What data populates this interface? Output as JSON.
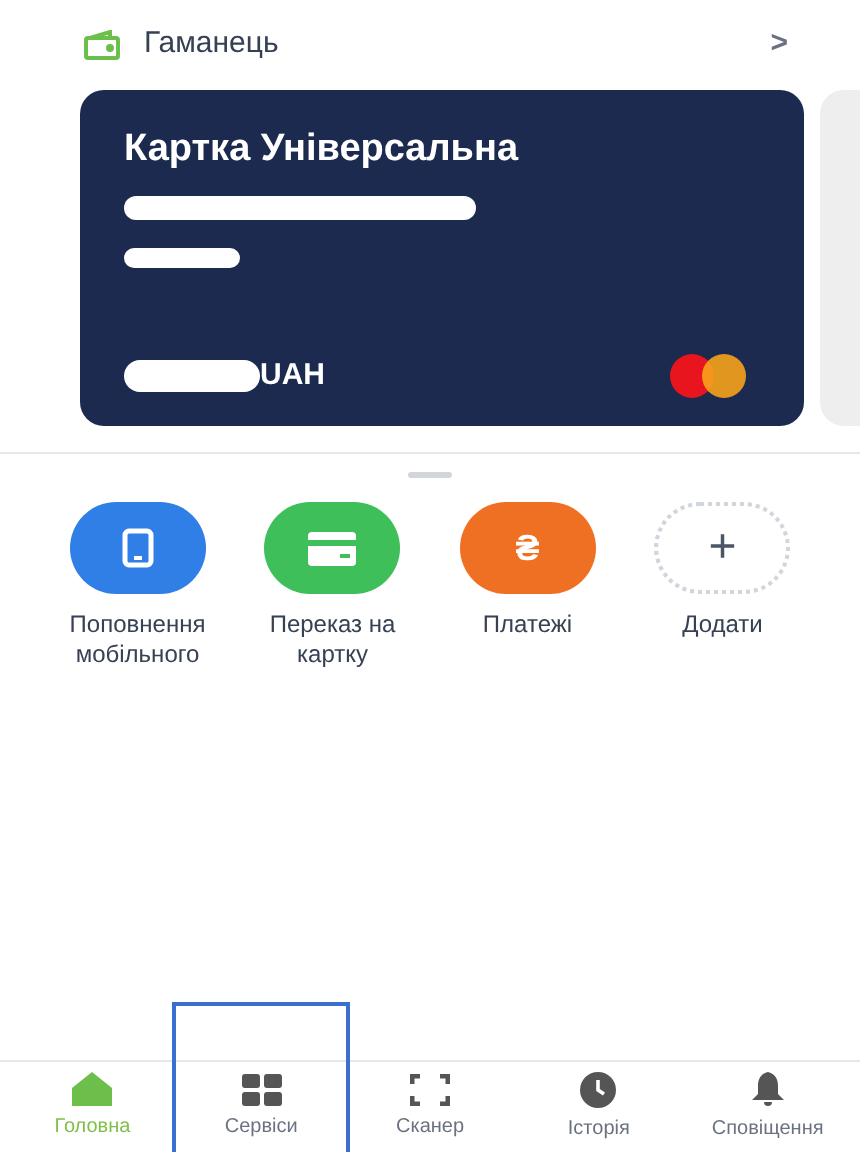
{
  "header": {
    "title": "Гаманець",
    "chevron": ">"
  },
  "card": {
    "name": "Картка Універсальна",
    "currency": "UAH"
  },
  "actions": [
    {
      "kind": "phone",
      "label": "Поповнення мобільного",
      "color": "#2f7fe6"
    },
    {
      "kind": "card",
      "label": "Переказ на картку",
      "color": "#3fbf5a"
    },
    {
      "kind": "hryvnia",
      "label": "Платежі",
      "color": "#f07023",
      "glyph": "₴"
    },
    {
      "kind": "add",
      "label": "Додати",
      "glyph": "+"
    }
  ],
  "nav": [
    {
      "kind": "home",
      "label": "Головна",
      "selected": true,
      "highlighted": false
    },
    {
      "kind": "grid",
      "label": "Сервіси",
      "selected": false,
      "highlighted": true
    },
    {
      "kind": "scan",
      "label": "Сканер",
      "selected": false,
      "highlighted": false
    },
    {
      "kind": "clock",
      "label": "Історія",
      "selected": false,
      "highlighted": false
    },
    {
      "kind": "bell",
      "label": "Сповіщення",
      "selected": false,
      "highlighted": false
    }
  ]
}
